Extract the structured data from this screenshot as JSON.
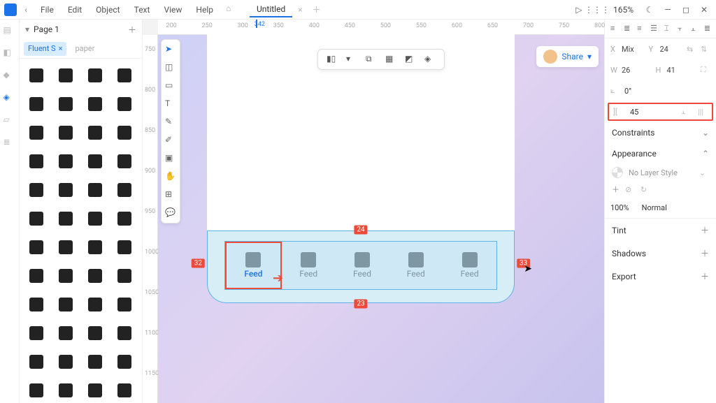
{
  "menu": {
    "items": [
      "File",
      "Edit",
      "Object",
      "Text",
      "View",
      "Help"
    ]
  },
  "doc": {
    "title": "Untitled"
  },
  "zoom": "165%",
  "page": {
    "name": "Page 1"
  },
  "tags": {
    "active": "Fluent S",
    "ghost": "paper"
  },
  "ruler_h": {
    "ticks": [
      "200",
      "250",
      "300",
      "350",
      "400",
      "450",
      "500",
      "550",
      "600",
      "650",
      "700",
      "750",
      "800"
    ],
    "marker": "342"
  },
  "ruler_v": {
    "ticks": [
      "750",
      "800",
      "850",
      "900",
      "950",
      "1000",
      "1050",
      "1100",
      "1150"
    ]
  },
  "share": {
    "label": "Share"
  },
  "tabs": {
    "label": "Feed"
  },
  "measure": {
    "top": "24",
    "bottom": "23",
    "left": "32",
    "right": "33"
  },
  "props": {
    "x_label": "X",
    "x": "Mix",
    "y_label": "Y",
    "y": "24",
    "w_label": "W",
    "w": "26",
    "h_label": "H",
    "h": "41",
    "rot": "0°",
    "gap": "45"
  },
  "sections": {
    "constraints": "Constraints",
    "appearance": "Appearance",
    "nolayer": "No Layer Style",
    "opacity": "100%",
    "blend": "Normal",
    "tint": "Tint",
    "shadows": "Shadows",
    "export": "Export"
  }
}
